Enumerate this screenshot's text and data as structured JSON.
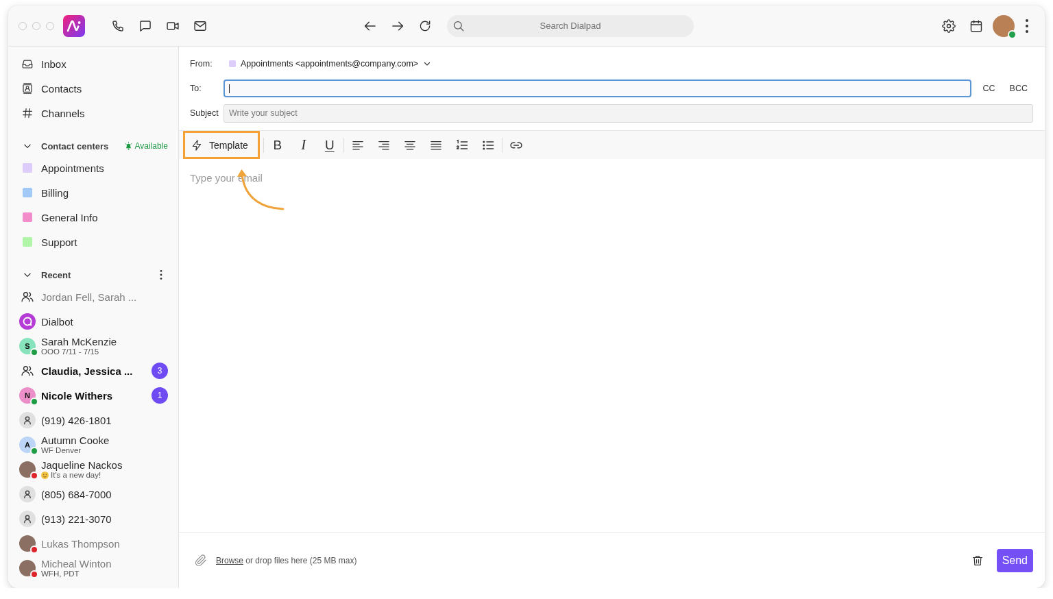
{
  "top_bar": {
    "search": {
      "placeholder": "Search Dialpad"
    },
    "user": {
      "presence": {
        "color": "#22a04b"
      }
    }
  },
  "sidebar": {
    "nav": [
      {
        "label": "Inbox",
        "selected": false
      },
      {
        "label": "Contacts",
        "selected": false
      },
      {
        "label": "Channels",
        "selected": false
      }
    ],
    "contact_centers": {
      "title": "Contact centers",
      "expanded": true,
      "status": "Available",
      "items": [
        {
          "label": "Appointments",
          "color": "#dccdfb",
          "selected": false
        },
        {
          "label": "Billing",
          "color": "#a3c9f6",
          "selected": false
        },
        {
          "label": "General Info",
          "color": "#f28ccb",
          "selected": false
        },
        {
          "label": "Support",
          "color": "#b0f5a8",
          "selected": false
        }
      ]
    },
    "recent": {
      "title": "Recent",
      "expanded": true,
      "items": [
        {
          "kind": "group",
          "name": "Jordan Fell, Sarah ...",
          "unread": false,
          "faded": true,
          "selected": false
        },
        {
          "kind": "bot",
          "name": "Dialbot",
          "unread": false,
          "faded": false,
          "selected": false
        },
        {
          "kind": "initial",
          "initial": "S",
          "color": "#86e3bb",
          "name": "Sarah McKenzie",
          "subtitle": "OOO 7/11 - 7/15",
          "presence": {
            "color": "#1f9d45"
          },
          "unread": false,
          "faded": false,
          "selected": false
        },
        {
          "kind": "group",
          "name": "Claudia, Jessica ...",
          "unread": true,
          "count": "3",
          "faded": false,
          "selected": false
        },
        {
          "kind": "initial",
          "initial": "N",
          "color": "#ec8fc9",
          "name": "Nicole Withers",
          "presence": {
            "color": "#1f9d45"
          },
          "unread": true,
          "count": "1",
          "faded": false,
          "selected": false
        },
        {
          "kind": "phone",
          "name": "(919) 426-1801",
          "unread": false,
          "faded": false,
          "selected": false
        },
        {
          "kind": "initial",
          "initial": "A",
          "color": "#bcd5f7",
          "name": "Autumn Cooke",
          "subtitle": "WF Denver",
          "presence": {
            "color": "#1f9d45"
          },
          "unread": false,
          "faded": false,
          "selected": false
        },
        {
          "kind": "photo",
          "name": "Jaqueline Nackos",
          "subtitle": "It's a new day!",
          "emoji": true,
          "presence": {
            "color": "#e0242b"
          },
          "unread": false,
          "faded": false,
          "selected": false
        },
        {
          "kind": "phone",
          "name": "(805) 684-7000",
          "unread": false,
          "faded": false,
          "selected": false
        },
        {
          "kind": "phone",
          "name": "(913) 221-3070",
          "unread": false,
          "faded": false,
          "selected": false
        },
        {
          "kind": "photo",
          "name": "Lukas Thompson",
          "presence": {
            "color": "#e0242b"
          },
          "unread": false,
          "faded": true,
          "selected": false
        },
        {
          "kind": "photo",
          "name": "Micheal Winton",
          "subtitle": "WFH, PDT",
          "presence": {
            "color": "#e0242b"
          },
          "unread": false,
          "faded": true,
          "selected": false
        }
      ]
    }
  },
  "compose": {
    "from": {
      "label": "From:",
      "sender": "Appointments <appointments@company.com>",
      "color": "#dccdfb"
    },
    "to": {
      "label": "To:",
      "focused": true
    },
    "cc": "CC",
    "bcc": "BCC",
    "subject": {
      "label": "Subject",
      "placeholder": "Write your subject"
    },
    "toolbar": {
      "template": {
        "label": "Template",
        "highlighted": true
      },
      "format_groups": [
        [
          {
            "kind": "bold",
            "label": "B"
          },
          {
            "kind": "italic",
            "label": "I"
          },
          {
            "kind": "underline",
            "label": "U"
          }
        ],
        [
          {
            "kind": "align-left"
          },
          {
            "kind": "align-right"
          },
          {
            "kind": "align-center"
          },
          {
            "kind": "justify"
          },
          {
            "kind": "numbered-list"
          },
          {
            "kind": "bullet-list"
          }
        ],
        [
          {
            "kind": "link"
          }
        ]
      ]
    },
    "editor": {
      "placeholder": "Type your email",
      "pointer_arrow": true
    },
    "attachments": {
      "link": "Browse",
      "hint": "or drop files here (25 MB max)"
    },
    "send": "Send"
  }
}
